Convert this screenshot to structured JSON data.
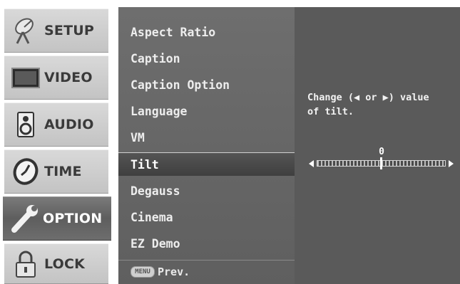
{
  "tabs": [
    {
      "label": "SETUP",
      "icon": "satellite-dish-icon",
      "active": false
    },
    {
      "label": "VIDEO",
      "icon": "tv-screen-icon",
      "active": false
    },
    {
      "label": "AUDIO",
      "icon": "speaker-icon",
      "active": false
    },
    {
      "label": "TIME",
      "icon": "clock-icon",
      "active": false
    },
    {
      "label": "OPTION",
      "icon": "wrench-icon",
      "active": true
    },
    {
      "label": "LOCK",
      "icon": "padlock-icon",
      "active": false
    }
  ],
  "menu": {
    "items": [
      {
        "label": "Aspect Ratio"
      },
      {
        "label": "Caption"
      },
      {
        "label": "Caption Option"
      },
      {
        "label": "Language"
      },
      {
        "label": "VM"
      },
      {
        "label": "Tilt"
      },
      {
        "label": "Degauss"
      },
      {
        "label": "Cinema"
      },
      {
        "label": "EZ Demo"
      }
    ],
    "selected_index": 5,
    "prev_key": "MENU",
    "prev_label": "Prev."
  },
  "detail": {
    "help_text": "Change (◀ or ▶) value\nof tilt.",
    "slider": {
      "value": "0",
      "min": -10,
      "max": 10,
      "current": 0
    }
  },
  "colors": {
    "tab_inactive": "#cfcfcf",
    "tab_active": "#6a6a6a",
    "menu_bg": "#686868",
    "detail_bg": "#5a5a5a"
  }
}
